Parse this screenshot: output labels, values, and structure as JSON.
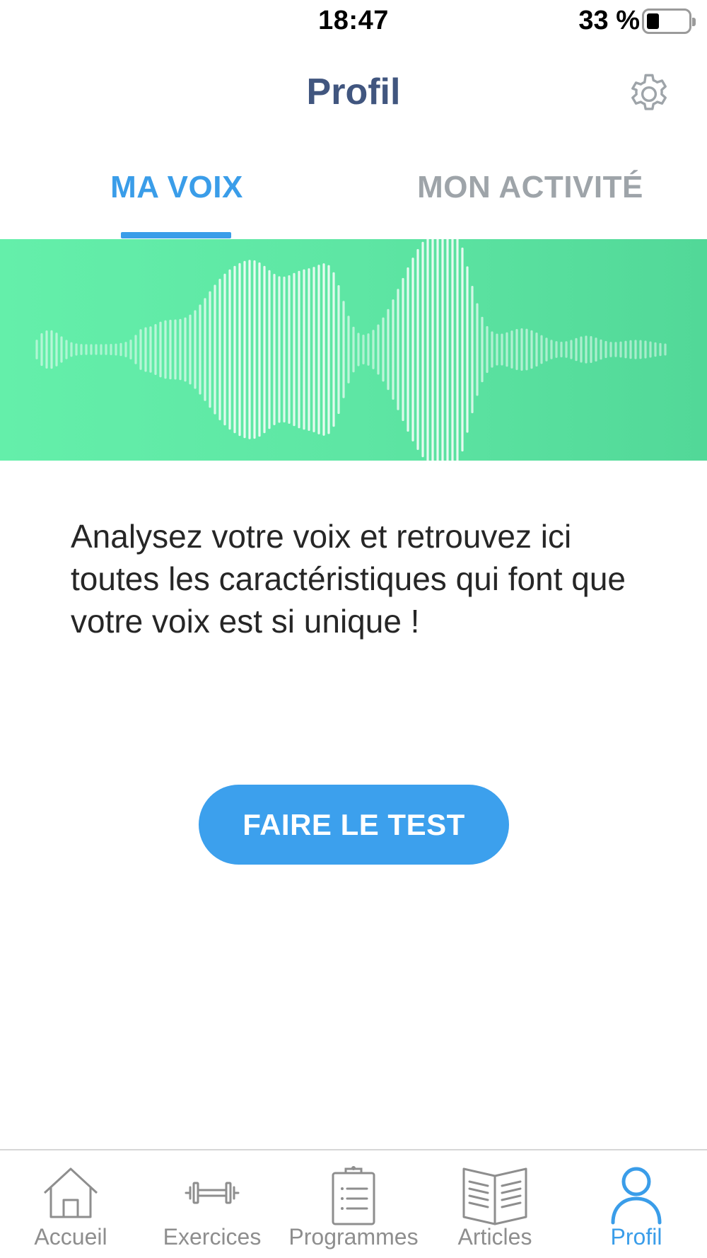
{
  "status_bar": {
    "time": "18:47",
    "battery_percent": "33 %",
    "battery_level": 0.33
  },
  "header": {
    "title": "Profil",
    "settings_icon": "gear-icon"
  },
  "tabs": [
    {
      "label": "MA VOIX",
      "active": true
    },
    {
      "label": "MON ACTIVITÉ",
      "active": false
    }
  ],
  "banner": {
    "icon": "sound-wave-illustration"
  },
  "main": {
    "description": "Analysez votre voix et retrouvez ici toutes les caractéristiques qui font que votre voix est si unique !",
    "cta_label": "FAIRE LE TEST"
  },
  "bottom_nav": {
    "items": [
      {
        "label": "Accueil",
        "icon": "home-icon",
        "active": false
      },
      {
        "label": "Exercices",
        "icon": "dumbbell-icon",
        "active": false
      },
      {
        "label": "Programmes",
        "icon": "clipboard-icon",
        "active": false
      },
      {
        "label": "Articles",
        "icon": "book-icon",
        "active": false
      },
      {
        "label": "Profil",
        "icon": "user-icon",
        "active": true
      }
    ]
  },
  "colors": {
    "accent": "#3a9de9",
    "title": "#41567f",
    "banner": "#5ee6a4",
    "inactive": "#9ea4a9"
  }
}
